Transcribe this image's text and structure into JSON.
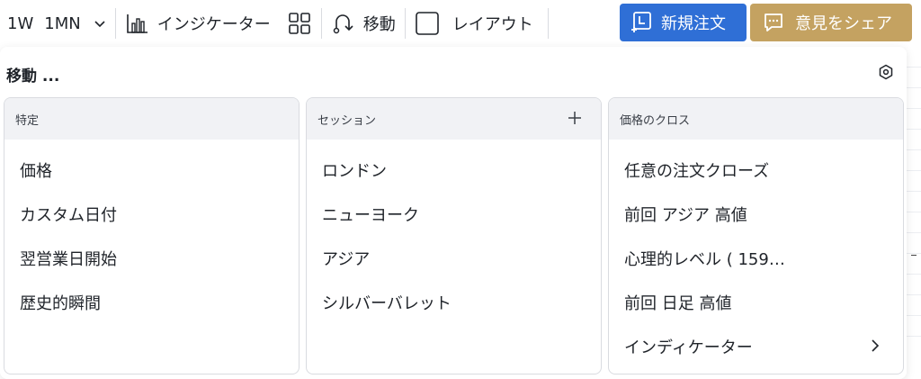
{
  "toolbar": {
    "interval_1": "1W",
    "interval_2": "1MN",
    "indicator_label": "インジケーター",
    "move_label": "移動",
    "layout_label": "レイアウト",
    "new_order_label": "新規注文",
    "feedback_label": "意見をシェア",
    "colors": {
      "new_order_bg": "#2f6fd6",
      "feedback_bg": "#c4a261"
    }
  },
  "panel": {
    "title": "移動 ...",
    "columns": [
      {
        "header": "特定",
        "items": [
          "価格",
          "カスタム日付",
          "翌営業日開始",
          "歴史的瞬間"
        ]
      },
      {
        "header": "セッション",
        "items": [
          "ロンドン",
          "ニューヨーク",
          "アジア",
          "シルバーバレット"
        ]
      },
      {
        "header": "価格のクロス",
        "items": [
          "任意の注文クローズ",
          "前回 アジア 高値",
          "心理的レベル ( 159…",
          "前回 日足 高値",
          "インディケーター"
        ]
      }
    ]
  }
}
